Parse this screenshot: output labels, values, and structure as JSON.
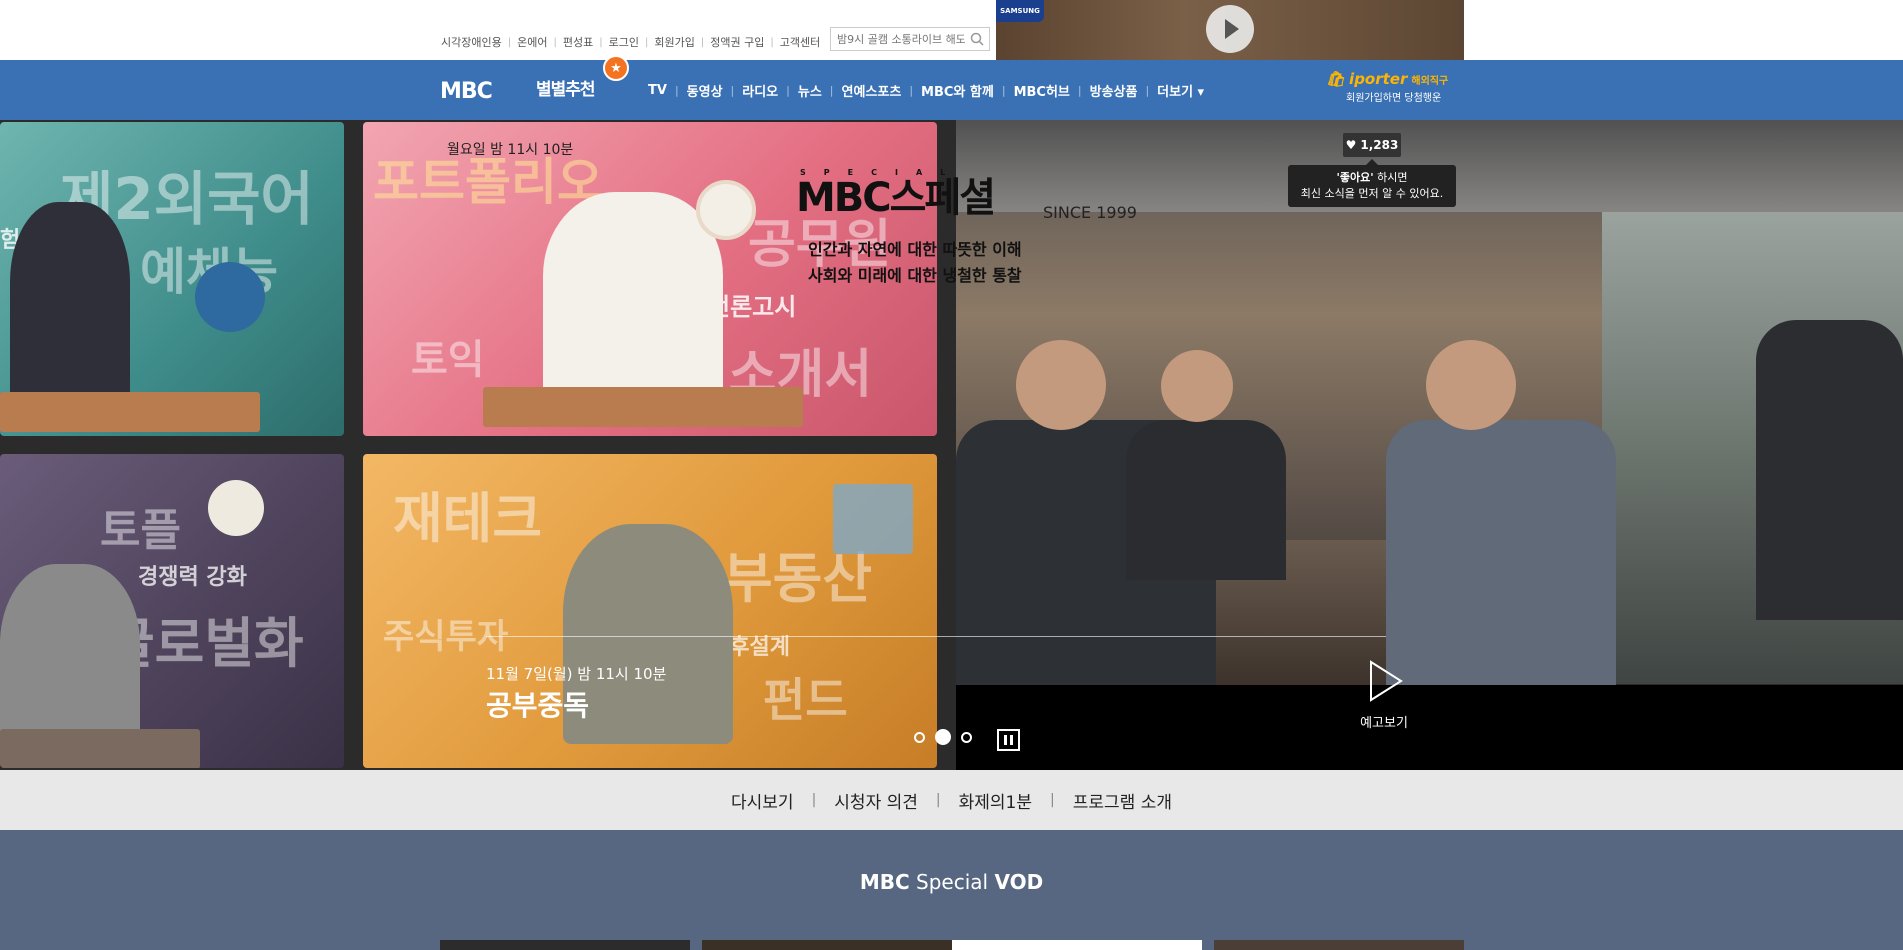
{
  "util_links": [
    "시각장애인용",
    "온에어",
    "편성표",
    "로그인",
    "회원가입",
    "정액권 구입",
    "고객센터"
  ],
  "search": {
    "placeholder": "밤9시 골캠 소통라이브 해도"
  },
  "ad": {
    "brand": "SAMSUNG"
  },
  "gnb": {
    "logo": "MBC",
    "star_rec": "별별추천",
    "menu": [
      "TV",
      "동영상",
      "라디오",
      "뉴스",
      "연예스포츠",
      "MBC와 함께",
      "MBC허브",
      "방송상품",
      "더보기 ▾"
    ]
  },
  "iporter": {
    "brand": "iporter",
    "tag": "해외직구",
    "sub": "회원가입하면 당첨행운"
  },
  "program": {
    "airtime": "월요일 밤 11시 10분",
    "special_word": "SPECIAL",
    "logo_text": "MBC스페셜",
    "since": "SINCE 1999",
    "tagline_1": "인간과 자연에 대한 따뜻한 이해",
    "tagline_2": "사회와 미래에 대한 냉철한 통찰"
  },
  "like": {
    "count": "1,283",
    "tip_bold": "'좋아요'",
    "tip_rest": " 하시면",
    "tip_line2": "최신 소식을 먼저 알 수 있어요."
  },
  "tiles": {
    "teal": [
      "제2외국어",
      "예체능",
      "험"
    ],
    "pink": [
      "포트폴리오",
      "공무원",
      "토익",
      "언론고시",
      "자기소개서"
    ],
    "purple": [
      "토플",
      "경쟁력 강화",
      "글로벌화"
    ],
    "orange": [
      "재테크",
      "부동산",
      "도후설계",
      "주식투자",
      "펀드"
    ]
  },
  "episode": {
    "date": "11월 7일(월) 밤 11시 10분",
    "title": "공부중독"
  },
  "carousel": {
    "slides": 3,
    "active": 1
  },
  "preview": {
    "label": "예고보기"
  },
  "subnav": [
    "다시보기",
    "시청자 의견",
    "화제의1분",
    "프로그램 소개"
  ],
  "vod": {
    "bold1": "MBC",
    "normal": " Special ",
    "bold2": "VOD"
  }
}
